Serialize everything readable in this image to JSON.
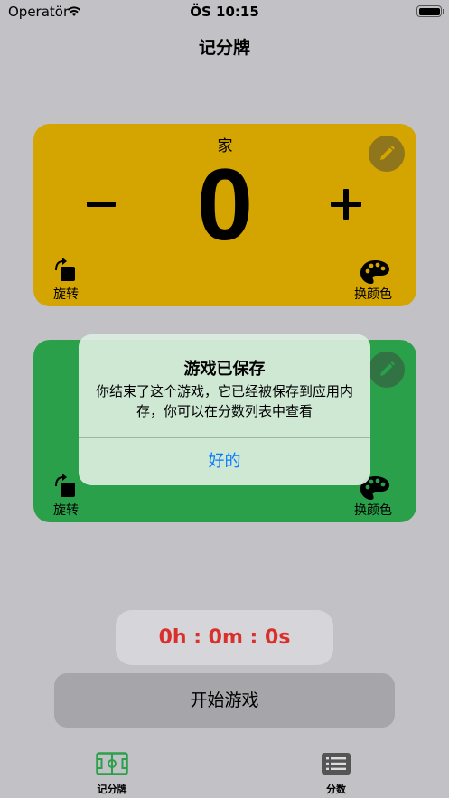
{
  "status_bar": {
    "carrier": "Operatör",
    "time": "ÖS 10:15"
  },
  "nav": {
    "title": "记分牌"
  },
  "home_card": {
    "team_name": "家",
    "score": "0",
    "color": "#d4a500",
    "rotate_label": "旋转",
    "color_label": "换颜色"
  },
  "away_card": {
    "color": "#2ba04a",
    "rotate_label": "旋转",
    "color_label": "换颜色"
  },
  "alert": {
    "title": "游戏已保存",
    "message": "你结束了这个游戏，它已经被保存到应用内存，你可以在分数列表中查看",
    "ok_label": "好的"
  },
  "timer": {
    "text": "0h : 0m : 0s",
    "color": "#d9302c"
  },
  "start_button": {
    "label": "开始游戏"
  },
  "tab_bar": {
    "items": [
      {
        "label": "记分牌",
        "icon": "field-icon",
        "color": "#2ba04a",
        "selected": true
      },
      {
        "label": "分数",
        "icon": "list-icon",
        "color": "#555555",
        "selected": false
      }
    ]
  }
}
